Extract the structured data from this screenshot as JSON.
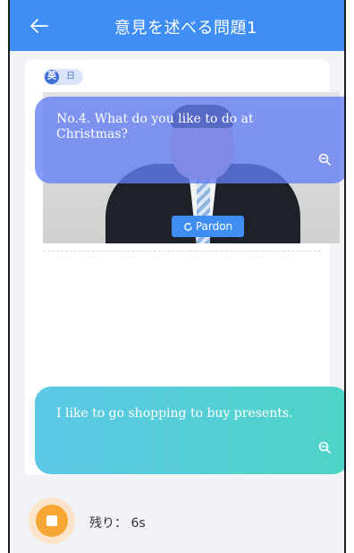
{
  "header": {
    "title": "意見を述べる問題1"
  },
  "language_toggle": {
    "en_label": "英",
    "ja_label": "日"
  },
  "question": {
    "text": "No.4. What do you like to do at Christmas?"
  },
  "pardon_button": {
    "label": "Pardon"
  },
  "answer": {
    "text": "I like to go shopping to buy presents."
  },
  "footer": {
    "remaining_label": "残り：",
    "remaining_value": "6s"
  },
  "colors": {
    "header": "#3f8ef5",
    "question_bubble": "#637cf5",
    "answer_bubble_start": "#5cc8e7",
    "answer_bubble_end": "#4ed4c6",
    "record_button": "#f6a632"
  },
  "icons": {
    "back": "arrow-left-icon",
    "pardon": "refresh-icon",
    "zoom": "zoom-out-icon",
    "record": "stop-icon"
  }
}
